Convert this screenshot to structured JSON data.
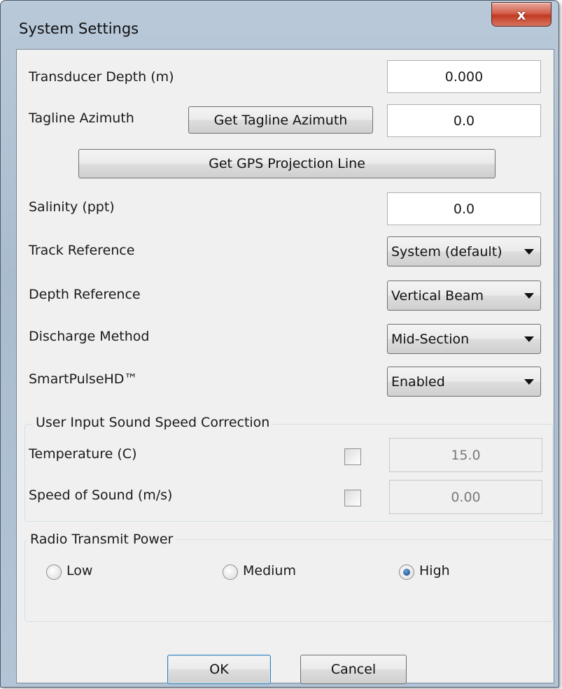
{
  "window": {
    "title": "System Settings",
    "close_glyph": "x"
  },
  "fields": {
    "transducer_depth": {
      "label": "Transducer Depth (m)",
      "value": "0.000"
    },
    "tagline_azimuth": {
      "label": "Tagline Azimuth",
      "button": "Get Tagline Azimuth",
      "value": "0.0"
    },
    "gps_projection_button": "Get GPS Projection Line",
    "salinity": {
      "label": "Salinity (ppt)",
      "value": "0.0"
    },
    "track_reference": {
      "label": "Track Reference",
      "selected": "System (default)"
    },
    "depth_reference": {
      "label": "Depth Reference",
      "selected": "Vertical Beam"
    },
    "discharge_method": {
      "label": "Discharge Method",
      "selected": "Mid-Section"
    },
    "smartpulse": {
      "label": "SmartPulseHD™",
      "selected": "Enabled"
    }
  },
  "sound_speed_group": {
    "title": "User Input Sound Speed Correction",
    "temperature": {
      "label": "Temperature (C)",
      "checked": false,
      "value": "15.0"
    },
    "speed_of_sound": {
      "label": "Speed of Sound (m/s)",
      "checked": false,
      "value": "0.00"
    }
  },
  "radio_group": {
    "title": "Radio Transmit Power",
    "options": [
      {
        "label": "Low",
        "checked": false
      },
      {
        "label": "Medium",
        "checked": false
      },
      {
        "label": "High",
        "checked": true
      }
    ]
  },
  "footer": {
    "ok": "OK",
    "cancel": "Cancel"
  }
}
